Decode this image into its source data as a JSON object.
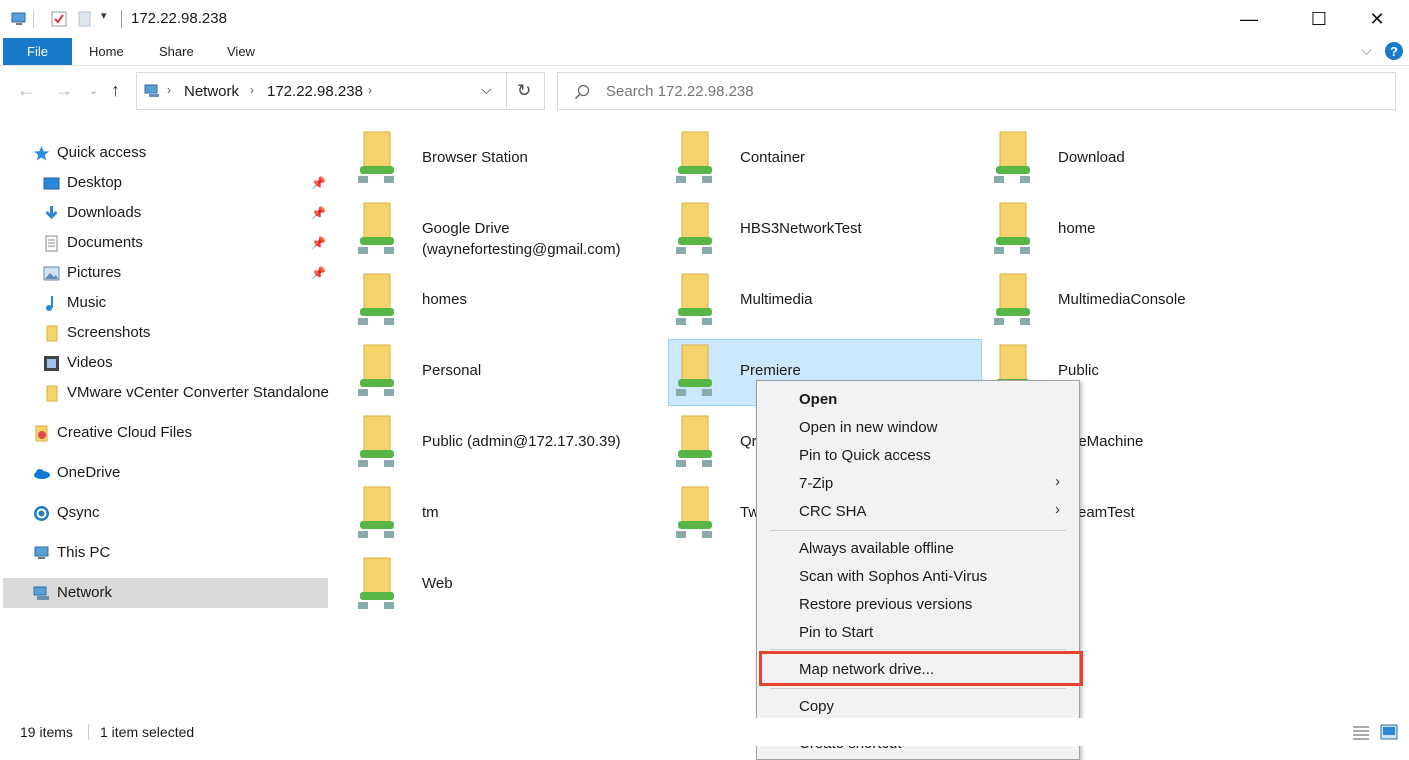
{
  "window": {
    "title": "172.22.98.238",
    "minimize_glyph": "—",
    "maximize_glyph": "☐",
    "close_glyph": "✕"
  },
  "ribbon": {
    "file_tab": "File",
    "tabs": [
      "Home",
      "Share",
      "View"
    ]
  },
  "address": {
    "crumbs": [
      "Network",
      "172.22.98.238"
    ]
  },
  "search": {
    "placeholder": "Search 172.22.98.238"
  },
  "nav": {
    "quick_access": "Quick access",
    "items": [
      {
        "label": "Desktop",
        "icon": "desktop-icon",
        "pinned": true
      },
      {
        "label": "Downloads",
        "icon": "downloads-icon",
        "pinned": true
      },
      {
        "label": "Documents",
        "icon": "documents-icon",
        "pinned": true
      },
      {
        "label": "Pictures",
        "icon": "pictures-icon",
        "pinned": true
      },
      {
        "label": "Music",
        "icon": "music-icon",
        "pinned": false
      },
      {
        "label": "Screenshots",
        "icon": "folder-icon",
        "pinned": false
      },
      {
        "label": "Videos",
        "icon": "videos-icon",
        "pinned": false
      },
      {
        "label": "VMware vCenter Converter Standalone",
        "icon": "folder-icon",
        "pinned": false
      }
    ],
    "roots": [
      {
        "label": "Creative Cloud Files",
        "icon": "creative-cloud-icon"
      },
      {
        "label": "OneDrive",
        "icon": "onedrive-icon"
      },
      {
        "label": "Qsync",
        "icon": "qsync-icon"
      },
      {
        "label": "This PC",
        "icon": "this-pc-icon"
      },
      {
        "label": "Network",
        "icon": "network-icon",
        "selected": true
      }
    ]
  },
  "shares": [
    [
      "Browser Station",
      "Container",
      "Download"
    ],
    [
      "Google Drive\n(waynefortesting@gmail.com)",
      "HBS3NetworkTest",
      "home"
    ],
    [
      "homes",
      "Multimedia",
      "MultimediaConsole"
    ],
    [
      "Personal",
      "Premiere",
      "Public"
    ],
    [
      "Public (admin@172.17.30.39)",
      "Qr",
      "neMachine"
    ],
    [
      "tm",
      "Tw",
      "eamTest"
    ],
    [
      "Web"
    ]
  ],
  "selected_share": "Premiere",
  "context_menu": {
    "groups": [
      [
        {
          "label": "Open",
          "bold": true
        },
        {
          "label": "Open in new window"
        },
        {
          "label": "Pin to Quick access"
        },
        {
          "label": "7-Zip",
          "submenu": true
        },
        {
          "label": "CRC SHA",
          "submenu": true
        }
      ],
      [
        {
          "label": "Always available offline"
        },
        {
          "label": "Scan with Sophos Anti-Virus"
        },
        {
          "label": "Restore previous versions"
        },
        {
          "label": "Pin to Start"
        }
      ],
      [
        {
          "label": "Map network drive...",
          "highlighted": true
        }
      ],
      [
        {
          "label": "Copy"
        }
      ],
      [
        {
          "label": "Create shortcut"
        }
      ]
    ],
    "highlight_color": "#e8412c"
  },
  "status": {
    "item_count": "19 items",
    "selection": "1 item selected"
  },
  "colors": {
    "accent": "#1979ca",
    "selection_bg": "#cce8ff",
    "nav_selected_bg": "#d9d9d9"
  }
}
